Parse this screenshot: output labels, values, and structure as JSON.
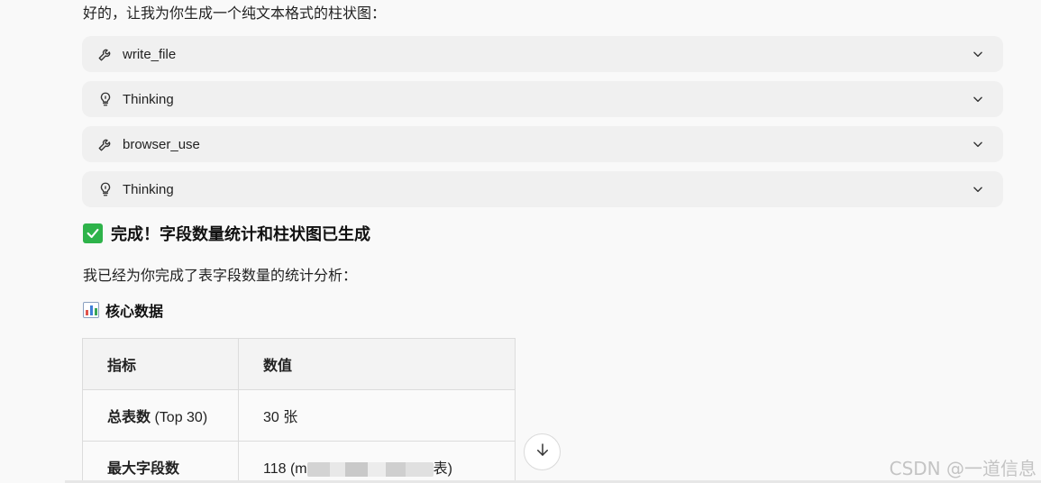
{
  "intro_text": "好的，让我为你生成一个纯文本格式的柱状图：",
  "tool_calls": [
    {
      "icon": "wrench-icon",
      "label": "write_file"
    },
    {
      "icon": "lightbulb-icon",
      "label": "Thinking"
    },
    {
      "icon": "wrench-icon",
      "label": "browser_use"
    },
    {
      "icon": "lightbulb-icon",
      "label": "Thinking"
    }
  ],
  "done_heading": "完成！字段数量统计和柱状图已生成",
  "paragraph": "我已经为你完成了表字段数量的统计分析：",
  "section_heading": "核心数据",
  "table": {
    "headers": [
      "指标",
      "数值"
    ],
    "rows": [
      {
        "label_bold": "总表数",
        "label_rest": " (Top 30)",
        "value": "30 张"
      },
      {
        "label_bold": "最大字段数",
        "label_rest": "",
        "value_prefix": "118 (m",
        "value_suffix": "表)"
      }
    ]
  },
  "watermark": "CSDN @一道信息",
  "colors": {
    "check_green": "#2eb34a",
    "tool_row_bg": "#f0f0f0",
    "page_bg": "#f9f9f9"
  }
}
